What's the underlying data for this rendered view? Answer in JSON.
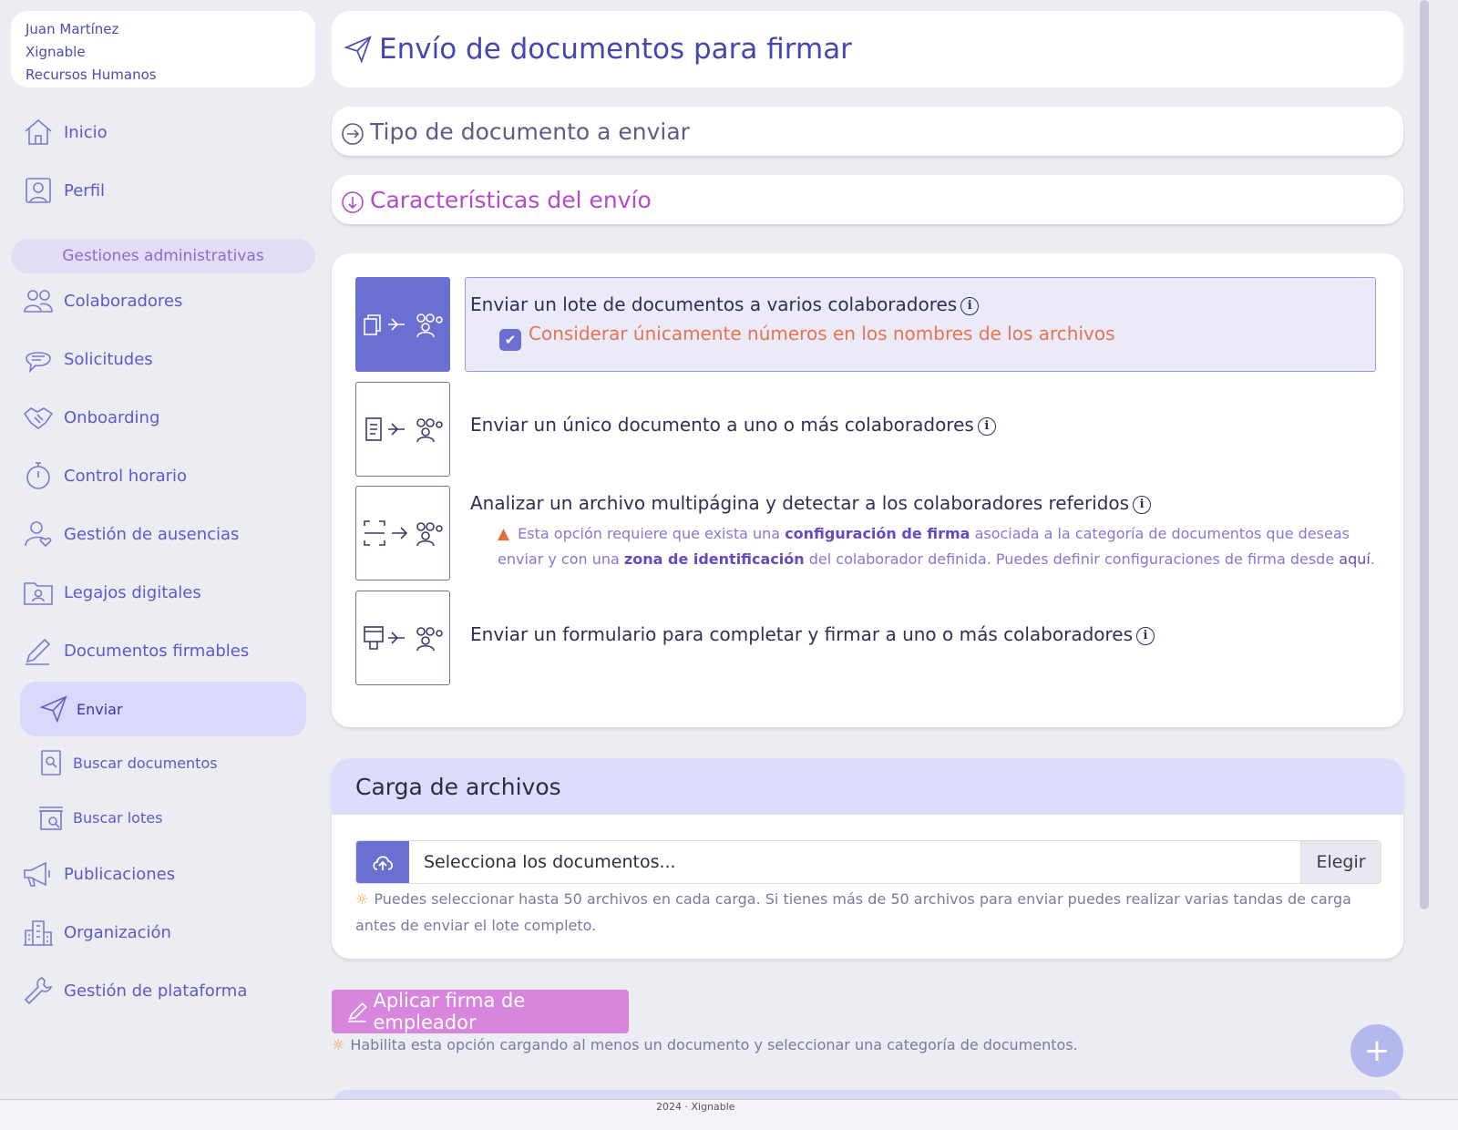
{
  "user": {
    "name": "Juan Martínez",
    "company": "Xignable",
    "department": "Recursos Humanos"
  },
  "nav": {
    "inicio": "Inicio",
    "perfil": "Perfil",
    "section": "Gestiones administrativas",
    "colaboradores": "Colaboradores",
    "solicitudes": "Solicitudes",
    "onboarding": "Onboarding",
    "control_horario": "Control horario",
    "ausencias": "Gestión de ausencias",
    "legajos": "Legajos digitales",
    "documentos": "Documentos firmables",
    "enviar": "Enviar",
    "buscar_documentos": "Buscar documentos",
    "buscar_lotes": "Buscar lotes",
    "publicaciones": "Publicaciones",
    "organizacion": "Organización",
    "plataforma": "Gestión de plataforma"
  },
  "page": {
    "title": "Envío de documentos para firmar"
  },
  "accordions": {
    "tipo": "Tipo de documento a enviar",
    "caracteristicas": "Características del envío"
  },
  "options": {
    "lote": "Enviar un lote de documentos a varios colaboradores",
    "lote_checkbox": "Considerar únicamente números en los nombres de los archivos",
    "unico": "Enviar un único documento a uno o más colaboradores",
    "analizar": "Analizar un archivo multipágina y detectar a los colaboradores referidos",
    "warning_1": "Esta opción requiere que exista una",
    "warning_b1": "configuración de firma",
    "warning_2": "asociada a la categoría de documentos que deseas enviar y con una",
    "warning_b2": "zona de identificación",
    "warning_3": "del colaborador definida. Puedes definir configuraciones de firma desde",
    "warning_link": "aquí",
    "formulario": "Enviar un formulario para completar y firmar a uno o más colaboradores",
    "info_glyph": "i"
  },
  "upload": {
    "heading": "Carga de archivos",
    "placeholder": "Selecciona los documentos...",
    "choose_label": "Elegir",
    "hint": "Puedes seleccionar hasta 50 archivos en cada carga. Si tienes más de 50 archivos para enviar puedes realizar varias tandas de carga antes de enviar el lote completo."
  },
  "signature": {
    "button_label": "Aplicar firma de empleador",
    "hint": "Habilita esta opción cargando al menos un documento y seleccionar una categoría de documentos."
  },
  "fab_label": "+",
  "footer": "2024 · Xignable",
  "colors": {
    "primary": "#6b6fd1",
    "accent": "#d885de",
    "accordion_open": "#b34bc9",
    "warning": "#e8734f"
  }
}
